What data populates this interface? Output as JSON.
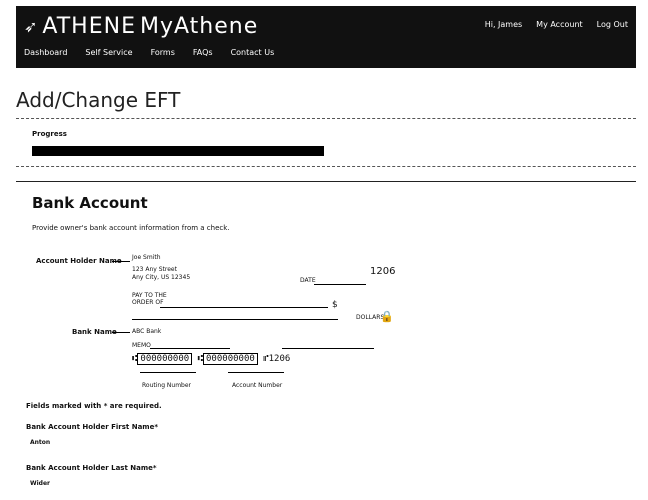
{
  "header": {
    "brand": "ATHENE",
    "product": "MyAthene",
    "greeting": "Hi, James",
    "my_account": "My Account",
    "logout": "Log Out",
    "nav": [
      "Dashboard",
      "Self Service",
      "Forms",
      "FAQs",
      "Contact Us"
    ]
  },
  "page": {
    "title": "Add/Change EFT",
    "progress_label": "Progress",
    "progress_pct": 49
  },
  "bank_account": {
    "section_title": "Bank Account",
    "hint": "Provide owner's bank account information from a check.",
    "account_holder_label": "Account Holder Name",
    "bank_name_label": "Bank Name",
    "check": {
      "name": "Joe Smith",
      "address1": "123 Any Street",
      "address2": "Any City, US 12345",
      "check_no": "1206",
      "date_label": "DATE",
      "pay_to_label": "PAY TO THE ORDER OF",
      "dollar_sign": "$",
      "dollars_label": "DOLLARS",
      "bank": "ABC Bank",
      "memo_label": "MEMO",
      "routing": "000000000",
      "account": "000000000",
      "micr_suffix": "1206",
      "routing_label": "Routing Number",
      "account_label": "Account Number"
    }
  },
  "form": {
    "required_note": "Fields marked with * are required.",
    "first_name_label": "Bank Account Holder First Name*",
    "first_name_value": "Anton",
    "last_name_label": "Bank Account Holder Last Name*",
    "last_name_value": "Wider"
  }
}
